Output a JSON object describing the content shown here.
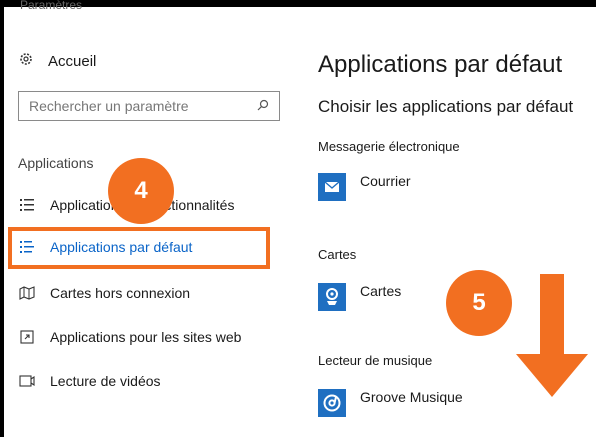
{
  "top_cut_text": "Paramètres",
  "sidebar": {
    "home_label": "Accueil",
    "search_placeholder": "Rechercher un paramètre",
    "section_title": "Applications",
    "items": [
      {
        "label": "Applications et fonctionnalités",
        "icon": "apps-features-icon"
      },
      {
        "label": "Applications par défaut",
        "icon": "default-apps-icon",
        "active": true
      },
      {
        "label": "Cartes hors connexion",
        "icon": "offline-maps-icon"
      },
      {
        "label": "Applications pour les sites web",
        "icon": "apps-websites-icon"
      },
      {
        "label": "Lecture de vidéos",
        "icon": "video-playback-icon"
      }
    ]
  },
  "main": {
    "title": "Applications par défaut",
    "subtitle": "Choisir les applications par défaut",
    "categories": [
      {
        "label": "Messagerie électronique",
        "app": "Courrier",
        "icon": "mail-icon"
      },
      {
        "label": "Cartes",
        "app": "Cartes",
        "icon": "maps-icon"
      },
      {
        "label": "Lecteur de musique",
        "app": "Groove Musique",
        "icon": "groove-icon"
      }
    ]
  },
  "annotations": {
    "badge_4": "4",
    "badge_5": "5",
    "accent_color": "#f26f21"
  },
  "colors": {
    "link_blue": "#0a64c8",
    "tile_blue": "#1f6fc1"
  }
}
